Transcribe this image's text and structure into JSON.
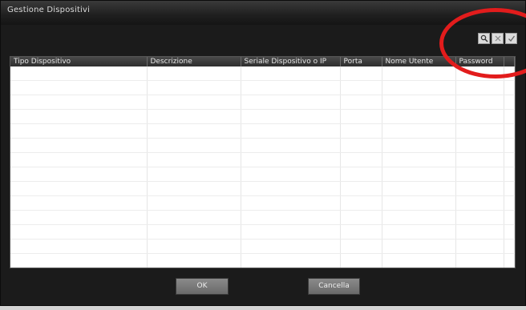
{
  "window": {
    "title": "Gestione Dispositivi"
  },
  "toolbar": {
    "buttons": [
      {
        "icon": "search-icon"
      },
      {
        "icon": "close-icon"
      },
      {
        "icon": "check-icon"
      }
    ]
  },
  "grid": {
    "columns": [
      "Tipo Dispositivo",
      "Descrizione",
      "Seriale Dispositivo o IP",
      "Porta",
      "Nome Utente",
      "Password"
    ],
    "rows": []
  },
  "footer": {
    "ok_label": "OK",
    "cancel_label": "Cancella"
  },
  "colors": {
    "highlight": "#e21c1c",
    "window_bg": "#1b1b1b"
  }
}
